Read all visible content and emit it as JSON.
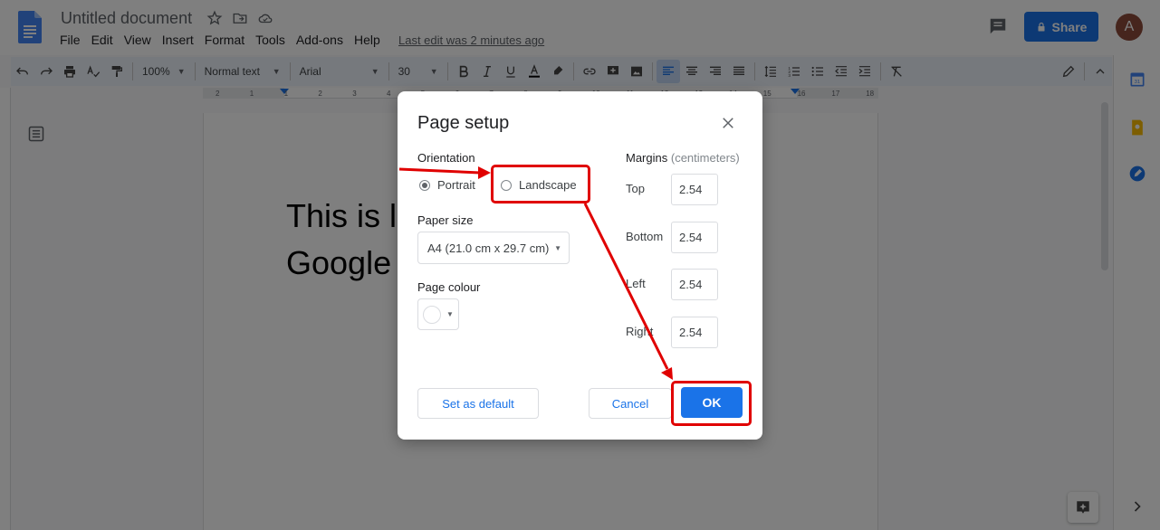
{
  "header": {
    "doc_title": "Untitled document",
    "menu": [
      "File",
      "Edit",
      "View",
      "Insert",
      "Format",
      "Tools",
      "Add-ons",
      "Help"
    ],
    "last_edit": "Last edit was 2 minutes ago",
    "share_label": "Share",
    "avatar_initial": "A"
  },
  "toolbar": {
    "zoom": "100%",
    "style": "Normal text",
    "font": "Arial",
    "size": "30"
  },
  "ruler": {
    "marks": [
      "2",
      "1",
      "1",
      "2",
      "3",
      "4",
      "5",
      "6",
      "7",
      "8",
      "9",
      "10",
      "11",
      "12",
      "13",
      "14",
      "15",
      "16",
      "17",
      "18"
    ]
  },
  "document": {
    "line1": "This is l",
    "line2": "Google"
  },
  "dialog": {
    "title": "Page setup",
    "orientation_label": "Orientation",
    "portrait_label": "Portrait",
    "landscape_label": "Landscape",
    "orientation_selected": "Portrait",
    "paper_size_label": "Paper size",
    "paper_size_value": "A4 (21.0 cm x 29.7 cm)",
    "page_colour_label": "Page colour",
    "margins_label": "Margins",
    "margins_unit": "(centimeters)",
    "margins": [
      {
        "label": "Top",
        "value": "2.54"
      },
      {
        "label": "Bottom",
        "value": "2.54"
      },
      {
        "label": "Left",
        "value": "2.54"
      },
      {
        "label": "Right",
        "value": "2.54"
      }
    ],
    "set_default_label": "Set as default",
    "cancel_label": "Cancel",
    "ok_label": "OK"
  },
  "colors": {
    "accent": "#1a73e8",
    "annotation_red": "#e00000"
  }
}
